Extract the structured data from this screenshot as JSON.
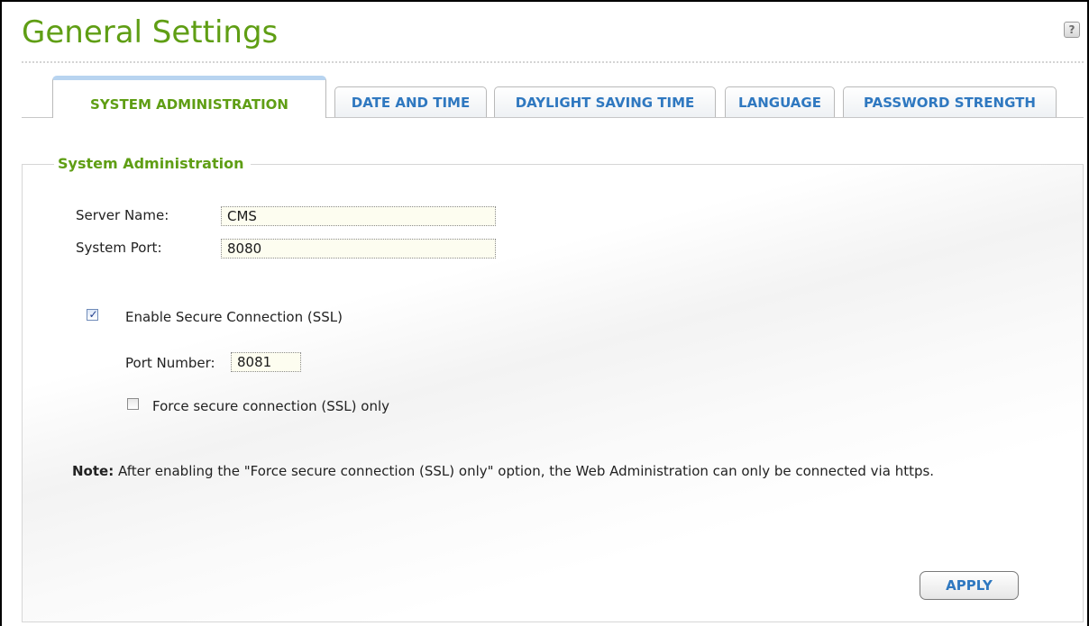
{
  "page": {
    "title": "General Settings",
    "help_icon": "question-mark-icon"
  },
  "tabs": [
    {
      "label": "SYSTEM ADMINISTRATION",
      "active": true
    },
    {
      "label": "DATE AND TIME",
      "active": false
    },
    {
      "label": "DAYLIGHT SAVING TIME",
      "active": false
    },
    {
      "label": "LANGUAGE",
      "active": false
    },
    {
      "label": "PASSWORD STRENGTH",
      "active": false
    }
  ],
  "section": {
    "legend": "System Administration",
    "server_name_label": "Server Name:",
    "server_name_value": "CMS",
    "system_port_label": "System Port:",
    "system_port_value": "8080",
    "ssl_checkbox_label": "Enable Secure Connection (SSL)",
    "ssl_checked": true,
    "port_number_label": "Port Number:",
    "port_number_value": "8081",
    "force_ssl_label": "Force secure connection (SSL) only",
    "force_ssl_checked": false,
    "note_label": "Note:",
    "note_text": " After enabling the \"Force secure connection (SSL) only\" option, the Web Administration can only be connected via https."
  },
  "actions": {
    "apply_label": "APPLY"
  },
  "colors": {
    "title_green": "#5f9e14",
    "tab_blue": "#2f78c0",
    "active_tab_accent": "#b8d4f0"
  }
}
